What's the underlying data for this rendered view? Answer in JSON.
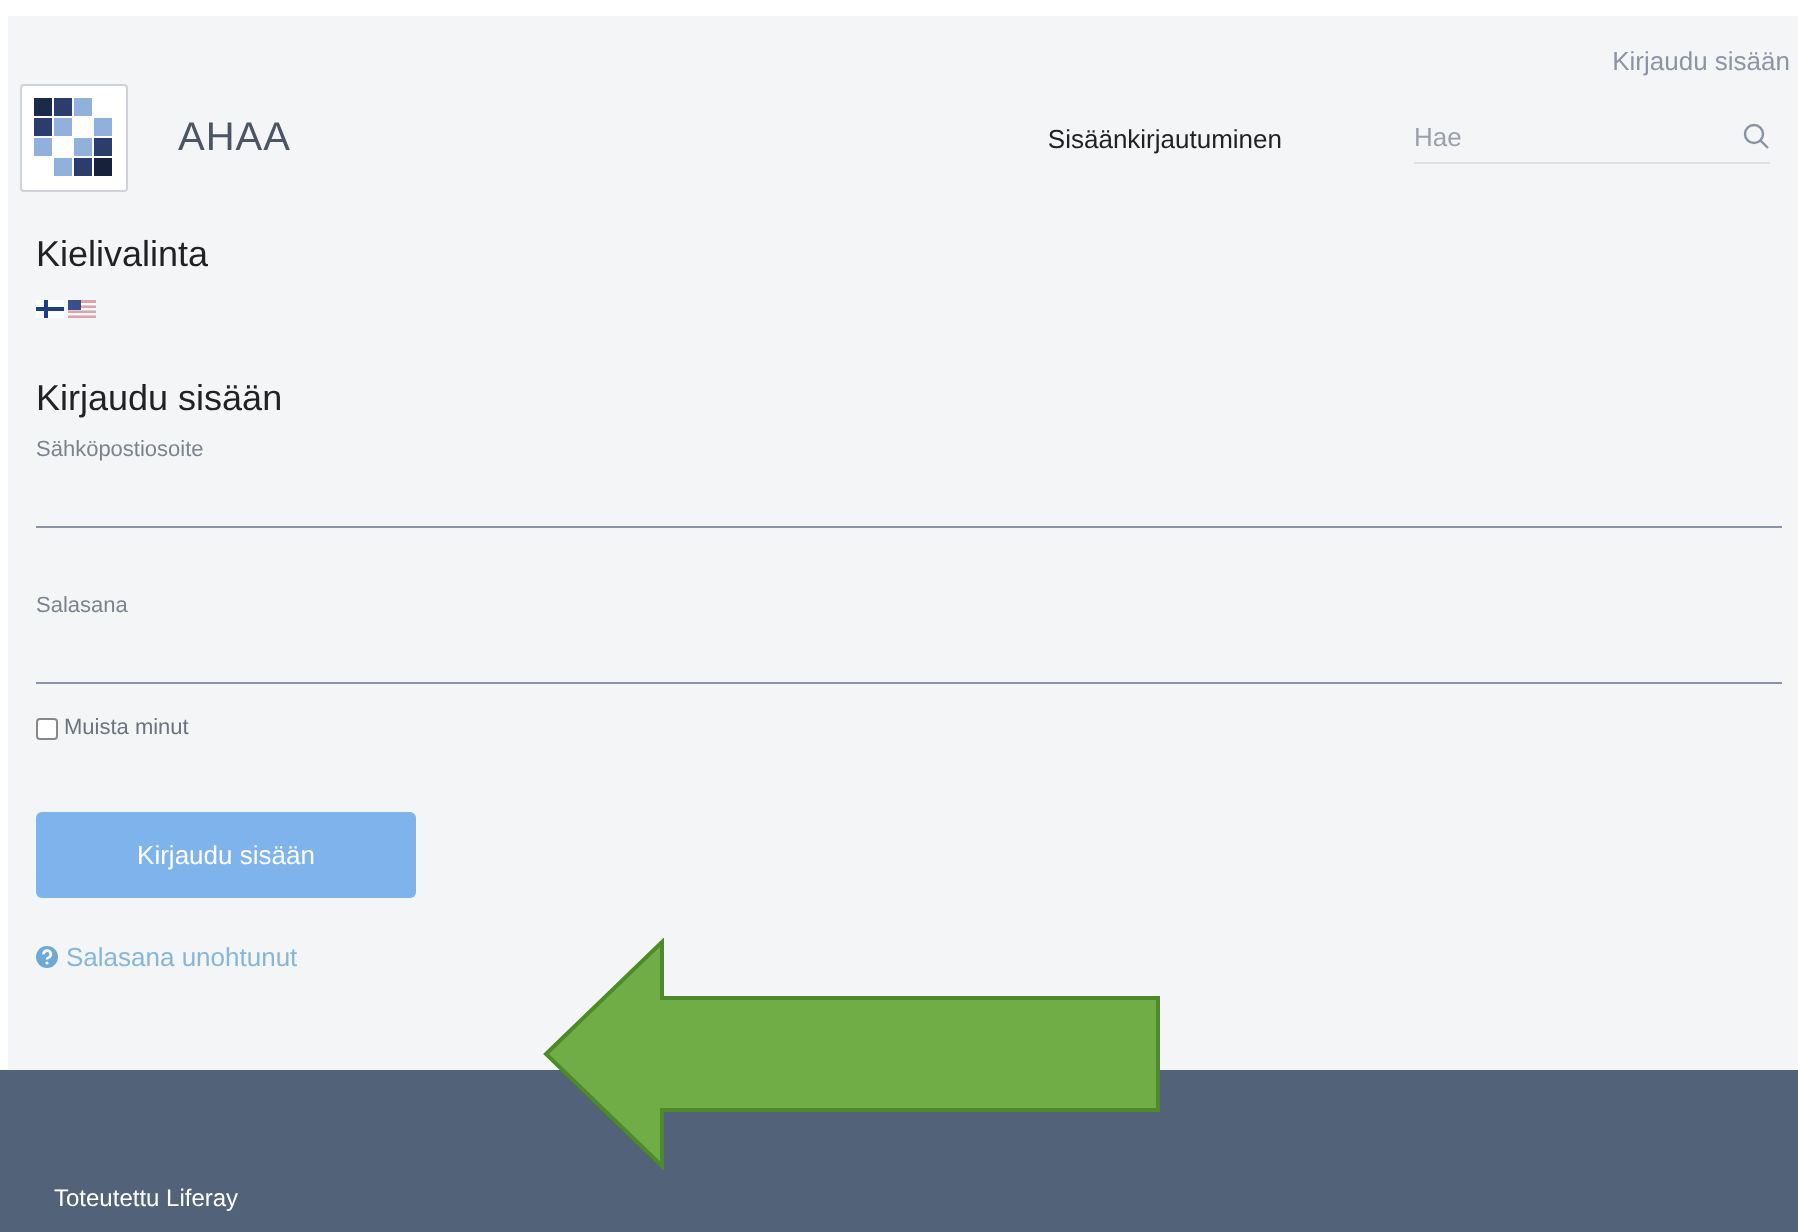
{
  "top_link": "Kirjaudu sisään",
  "header": {
    "site_name": "AHAA",
    "nav": [
      {
        "label": "Sisäänkirjautuminen"
      }
    ],
    "search": {
      "placeholder": "Hae"
    }
  },
  "language_section": {
    "title": "Kielivalinta",
    "flags": [
      {
        "kind": "finland"
      },
      {
        "kind": "usa"
      }
    ]
  },
  "login": {
    "title": "Kirjaudu sisään",
    "fields": [
      {
        "label": "Sähköpostiosoite"
      },
      {
        "label": "Salasana"
      }
    ],
    "remember": {
      "label": "Muista minut",
      "checked": false
    },
    "submit": "Kirjaudu sisään",
    "forgot": "Salasana unohtunut"
  },
  "footer": {
    "text": "Toteutettu Liferay"
  }
}
